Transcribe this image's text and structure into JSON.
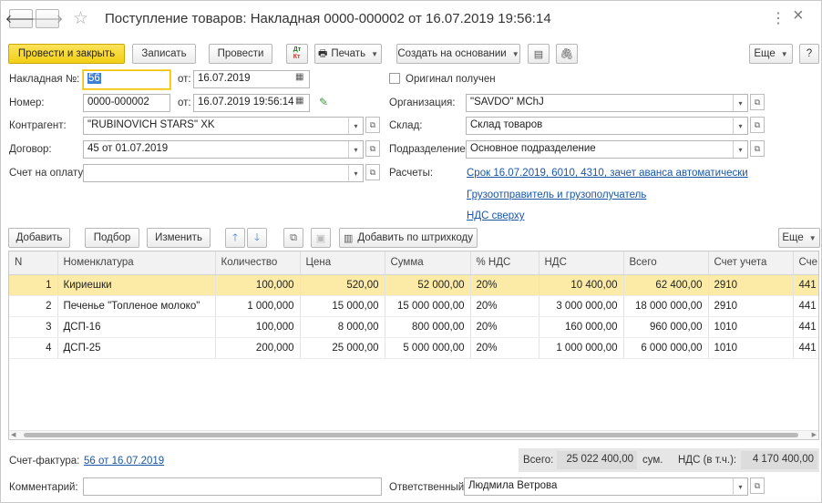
{
  "header": {
    "title": "Поступление товаров: Накладная 0000-000002 от 16.07.2019 19:56:14",
    "more_label": "⋮",
    "close_label": "×"
  },
  "toolbar": {
    "post_close": "Провести и закрыть",
    "save": "Записать",
    "post": "Провести",
    "print": "Печать",
    "create_based": "Создать на основании",
    "more": "Еще",
    "help": "?"
  },
  "form": {
    "invoice_label": "Накладная №:",
    "invoice_value": "56",
    "from_label": "от:",
    "invoice_date": "16.07.2019",
    "original_label": "Оригинал получен",
    "number_label": "Номер:",
    "number_value": "0000-000002",
    "number_date": "16.07.2019 19:56:14",
    "org_label": "Организация:",
    "org_value": "\"SAVDO\" MChJ",
    "contractor_label": "Контрагент:",
    "contractor_value": "\"RUBINOVICH STARS\" XK",
    "warehouse_label": "Склад:",
    "warehouse_value": "Склад товаров",
    "contract_label": "Договор:",
    "contract_value": "45 от 01.07.2019",
    "division_label": "Подразделение:",
    "division_value": "Основное подразделение",
    "payment_label": "Счет на оплату:",
    "payment_value": "",
    "settlements_label": "Расчеты:",
    "settlements_link": "Срок 16.07.2019, 6010, 4310, зачет аванса автоматически",
    "shipper_link": "Грузоотправитель и грузополучатель",
    "vat_link": "НДС сверху"
  },
  "table_toolbar": {
    "add": "Добавить",
    "select": "Подбор",
    "change": "Изменить",
    "barcode": "Добавить по штрихкоду",
    "more": "Еще"
  },
  "table": {
    "columns": [
      "N",
      "Номенклатура",
      "Количество",
      "Цена",
      "Сумма",
      "% НДС",
      "НДС",
      "Всего",
      "Счет учета",
      "Сче"
    ],
    "rows": [
      [
        "1",
        "Кириешки",
        "100,000",
        "520,00",
        "52 000,00",
        "20%",
        "10 400,00",
        "62 400,00",
        "2910",
        "441"
      ],
      [
        "2",
        "Печенье \"Топленое молоко\"",
        "1 000,000",
        "15 000,00",
        "15 000 000,00",
        "20%",
        "3 000 000,00",
        "18 000 000,00",
        "2910",
        "441"
      ],
      [
        "3",
        "ДСП-16",
        "100,000",
        "8 000,00",
        "800 000,00",
        "20%",
        "160 000,00",
        "960 000,00",
        "1010",
        "441"
      ],
      [
        "4",
        "ДСП-25",
        "200,000",
        "25 000,00",
        "5 000 000,00",
        "20%",
        "1 000 000,00",
        "6 000 000,00",
        "1010",
        "441"
      ]
    ]
  },
  "footer": {
    "invoice_label": "Счет-фактура:",
    "invoice_link": "56 от 16.07.2019",
    "total_label": "Всего:",
    "total_value": "25 022 400,00",
    "currency": "сум.",
    "vat_label": "НДС (в т.ч.):",
    "vat_value": "4 170 400,00",
    "comment_label": "Комментарий:",
    "comment_value": "",
    "responsible_label": "Ответственный:",
    "responsible_value": "Людмила Ветрова"
  },
  "colors": {
    "primary_button": "#f2cf16",
    "selected_row": "#fbeba7",
    "link": "#1a56a6"
  }
}
